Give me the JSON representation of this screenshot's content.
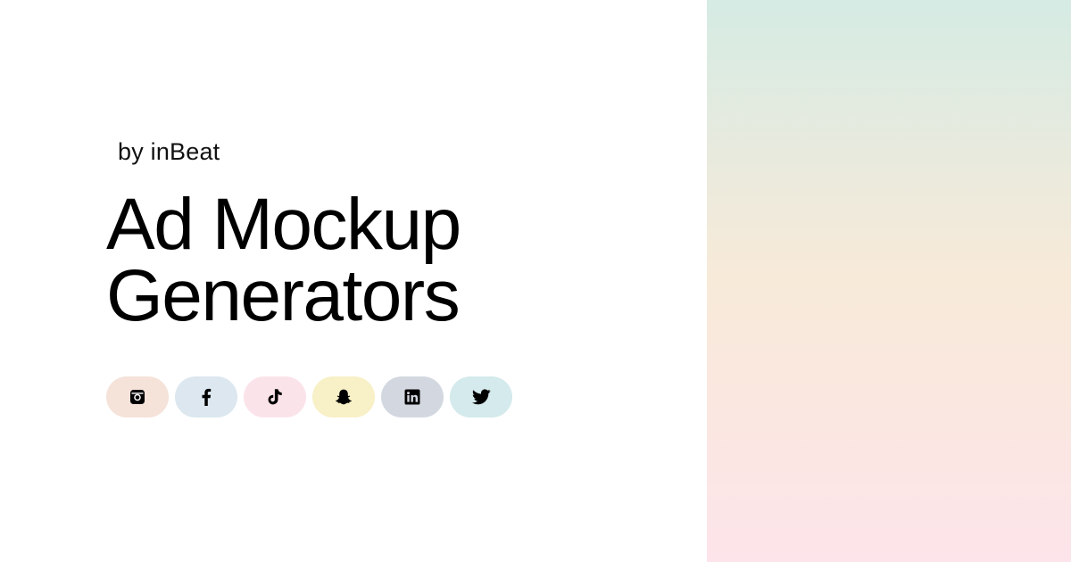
{
  "byline": "by inBeat",
  "headline": {
    "line1": "Ad Mockup",
    "line2": "Generators"
  },
  "platforms": [
    {
      "name": "instagram",
      "icon": "instagram-icon",
      "bg": "#f5e2d9"
    },
    {
      "name": "facebook",
      "icon": "facebook-icon",
      "bg": "#dce7ef"
    },
    {
      "name": "tiktok",
      "icon": "tiktok-icon",
      "bg": "#fbe3ea"
    },
    {
      "name": "snapchat",
      "icon": "snapchat-icon",
      "bg": "#f8f0c6"
    },
    {
      "name": "linkedin",
      "icon": "linkedin-icon",
      "bg": "#d3d8e0"
    },
    {
      "name": "twitter",
      "icon": "twitter-icon",
      "bg": "#d4eaec"
    }
  ],
  "colors": {
    "gradient_top": "#d5ebe4",
    "gradient_middle": "#f8ead9",
    "gradient_bottom": "#fde4ea",
    "text": "#000000"
  }
}
